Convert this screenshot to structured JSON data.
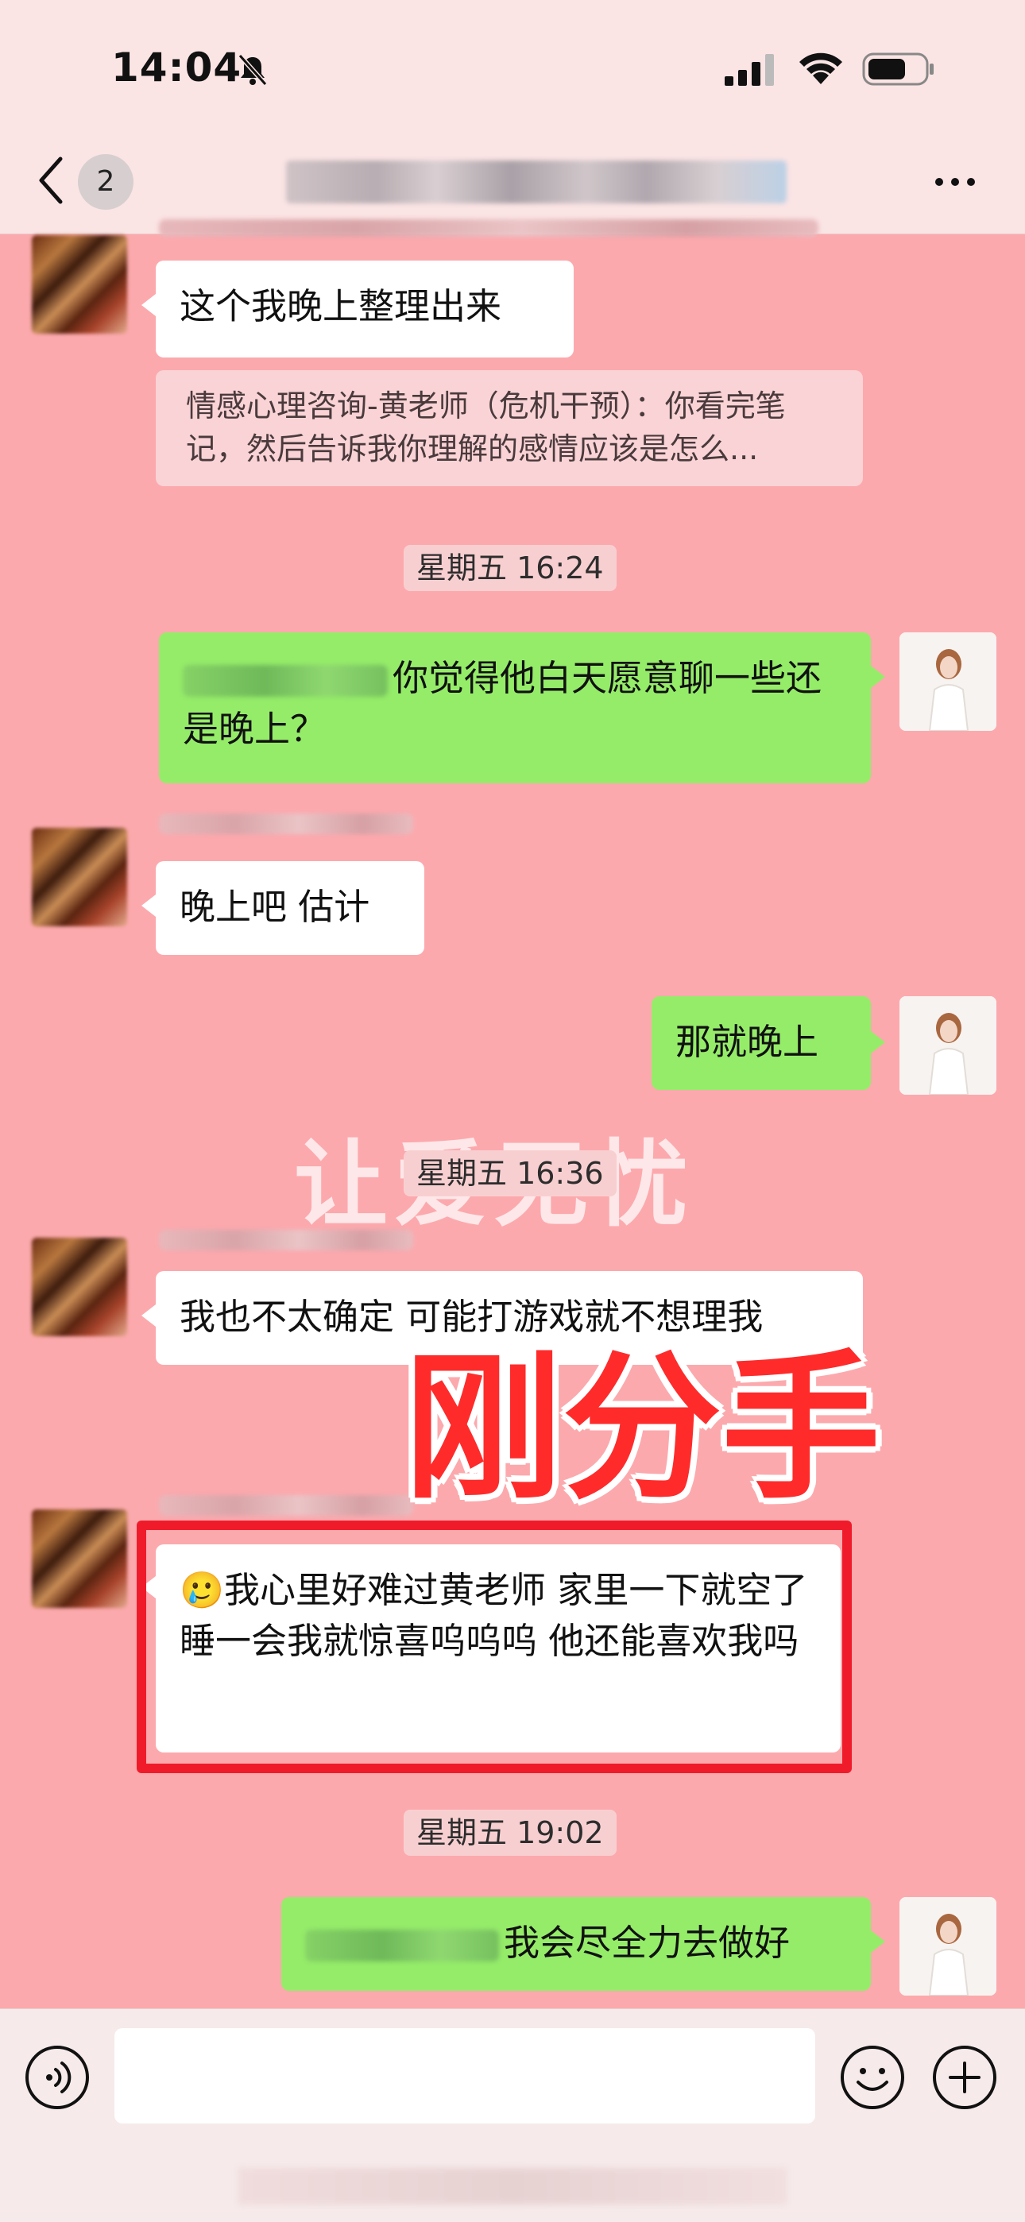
{
  "status_bar": {
    "time": "14:04"
  },
  "nav": {
    "unread_count": "2"
  },
  "messages": {
    "m1_text": "这个我晚上整理出来",
    "m1_quote": "情感心理咨询-黄老师（危机干预）：你看完笔记，然后告诉我你理解的感情应该是怎么...",
    "ts1": "星期五 16:24",
    "m2_text": "你觉得他白天愿意聊一些还是晚上？",
    "m3_text": "晚上吧 估计",
    "m4_text": "那就晚上",
    "ts2": "星期五 16:36",
    "m5_text": "我也不太确定 可能打游戏就不想理我",
    "m6_emoji": "🥲",
    "m6_text": "我心里好难过黄老师 家里一下就空了睡一会我就惊喜呜呜呜  他还能喜欢我吗",
    "ts3": "星期五 19:02",
    "m7_text": "我会尽全力去做好"
  },
  "overlay": {
    "watermark": "让爱无忧",
    "title": "刚分手",
    "highlight_color": "#f01b2a"
  },
  "colors": {
    "background": "#fca9ad",
    "bubble_out": "#95ec69",
    "bubble_in": "#ffffff"
  },
  "icons": [
    "mute-bell-icon",
    "signal-icon",
    "wifi-icon",
    "battery-icon",
    "back-chevron-icon",
    "more-icon",
    "voice-icon",
    "emoji-icon",
    "plus-icon"
  ]
}
